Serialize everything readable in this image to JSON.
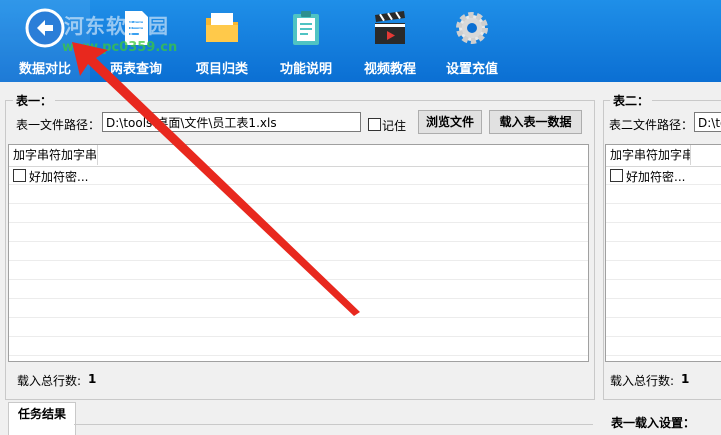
{
  "watermark": {
    "main": "河东软件园",
    "url": "www.pc0359.cn"
  },
  "toolbar": {
    "items": [
      {
        "label": "数据对比",
        "icon": "compare-icon"
      },
      {
        "label": "两表查询",
        "icon": "document-icon"
      },
      {
        "label": "项目归类",
        "icon": "folder-icon"
      },
      {
        "label": "功能说明",
        "icon": "clipboard-icon"
      },
      {
        "label": "视频教程",
        "icon": "clapperboard-icon"
      },
      {
        "label": "设置充值",
        "icon": "gear-icon"
      }
    ]
  },
  "table1": {
    "title": "表一：",
    "path_label": "表一文件路径：",
    "path_value": "D:\\tools\\桌面\\文件\\员工表1.xls",
    "remember_label": "记住",
    "browse_label": "浏览文件",
    "load_label": "载入表一数据",
    "column_header": "加字串符加字串",
    "row1_text": "好加符密...",
    "total_label": "载入总行数:",
    "total_value": "1"
  },
  "table2": {
    "title": "表二：",
    "path_label": "表二文件路径：",
    "path_value": "D:\\to",
    "column_header": "加字串符加字串",
    "row1_text": "好加符密...",
    "total_label": "载入总行数:",
    "total_value": "1",
    "settings_label": "表一载入设置："
  },
  "results": {
    "tab_label": "任务结果"
  },
  "colors": {
    "toolbar": "#0b6fd3",
    "arrow": "#e8281e"
  }
}
